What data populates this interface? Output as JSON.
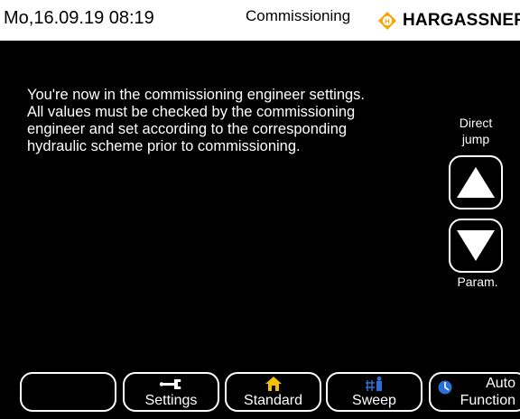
{
  "header": {
    "datetime": "Mo,16.09.19 08:19",
    "title": "Commissioning",
    "brand": "HARGASSNER",
    "brand_color": "#f7a400"
  },
  "main": {
    "message": "You're now in the commissioning engineer settings.\nAll values must be checked by the commissioning\nengineer and set according to the corresponding\nhydraulic scheme prior to commissioning."
  },
  "nav": {
    "direct_jump_label": "Direct\njump",
    "up_icon": "triangle-up-icon",
    "down_icon": "triangle-down-icon",
    "param_label": "Param."
  },
  "footer": {
    "settings_label": "Settings",
    "settings_icon": "wrench-icon",
    "standard_label": "Standard",
    "standard_icon": "house-icon",
    "standard_icon_color": "#f2c200",
    "sweep_label": "Sweep",
    "sweep_icon": "chimney-sweep-icon",
    "sweep_icon_color": "#2a6fd6",
    "auto_line1": "Auto",
    "auto_line2": "Function",
    "auto_icon": "clock-icon",
    "auto_icon_color": "#2a6fd6"
  }
}
